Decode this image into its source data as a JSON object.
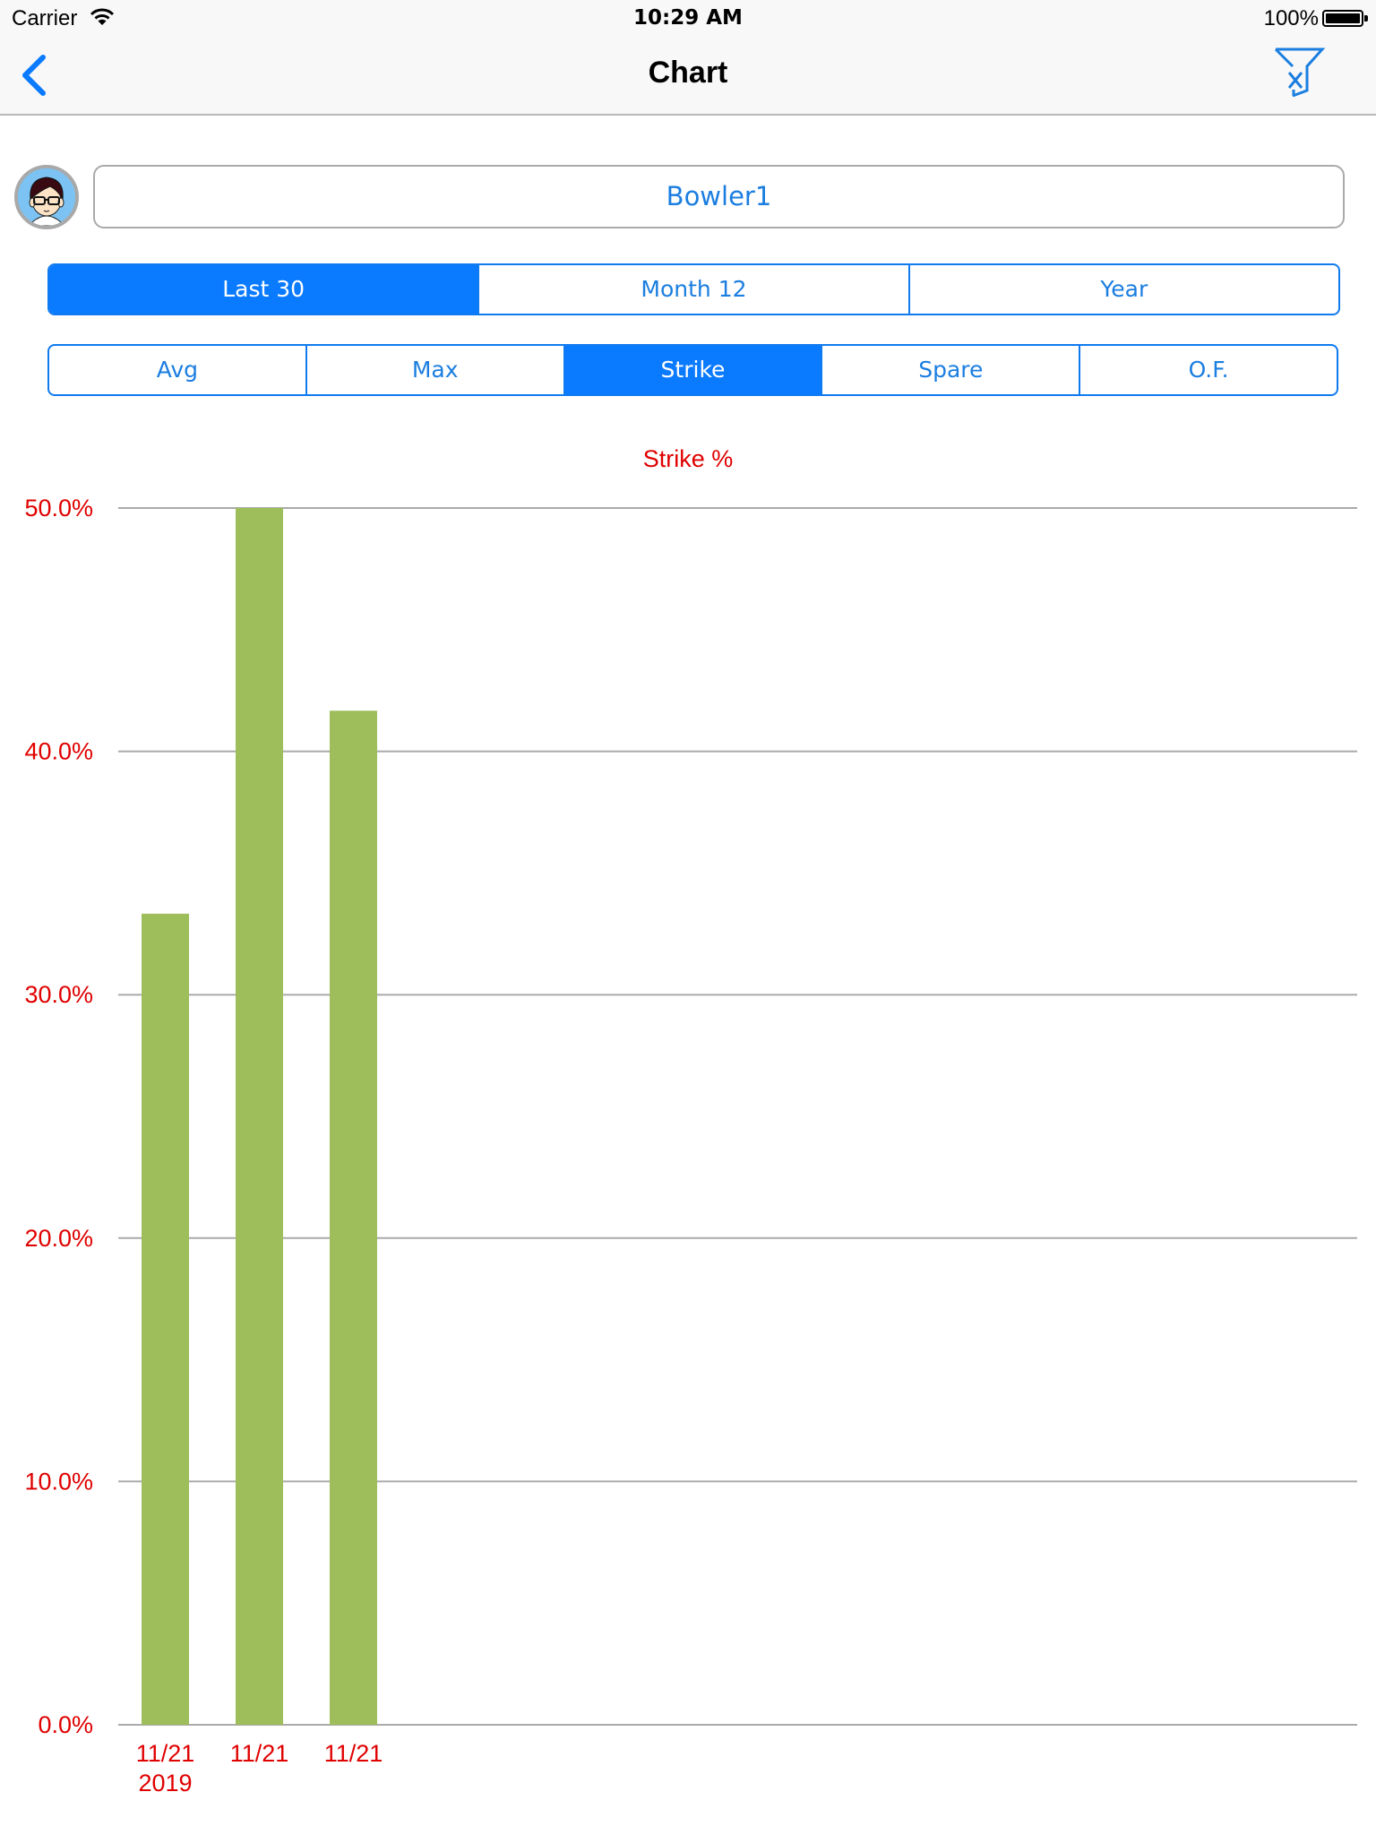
{
  "status_bar": {
    "carrier": "Carrier",
    "time": "10:29 AM",
    "battery_percent": "100%",
    "battery_level": 1.0
  },
  "nav": {
    "title": "Chart",
    "back_icon": "chevron-left-icon",
    "filter_icon": "clear-filter-icon"
  },
  "bowler": {
    "name": "Bowler1",
    "avatar_icon": "bowler-avatar"
  },
  "period_segments": {
    "selected": 0,
    "items": [
      {
        "label": "Last 30"
      },
      {
        "label": "Month 12"
      },
      {
        "label": "Year"
      }
    ]
  },
  "metric_segments": {
    "selected": 2,
    "items": [
      {
        "label": "Avg"
      },
      {
        "label": "Max"
      },
      {
        "label": "Strike"
      },
      {
        "label": "Spare"
      },
      {
        "label": "O.F."
      }
    ]
  },
  "colors": {
    "accent": "#0a7aff",
    "bar": "#9dbe5a",
    "axis_text": "#e00000",
    "grid": "#aaaaaa"
  },
  "chart_data": {
    "type": "bar",
    "title": "Strike %",
    "xlabel": "",
    "ylabel": "",
    "categories": [
      "11/21\n2019",
      "11/21",
      "11/21"
    ],
    "values": [
      33.33,
      50.0,
      41.67
    ],
    "ylim": [
      0,
      50
    ],
    "yticks": [
      0,
      10,
      20,
      30,
      40,
      50
    ],
    "ytick_labels": [
      "0.0%",
      "10.0%",
      "20.0%",
      "30.0%",
      "40.0%",
      "50.0%"
    ],
    "grid": true,
    "legend": "none"
  }
}
